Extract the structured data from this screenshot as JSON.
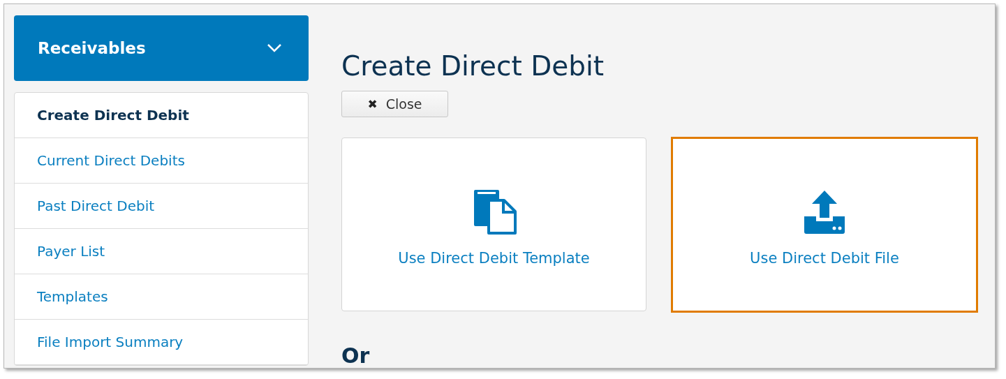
{
  "sidebar": {
    "header": {
      "title": "Receivables",
      "expanded": true
    },
    "items": [
      {
        "label": "Create Direct Debit",
        "selected": true
      },
      {
        "label": "Current Direct Debits",
        "selected": false
      },
      {
        "label": "Past Direct Debit",
        "selected": false
      },
      {
        "label": "Payer List",
        "selected": false
      },
      {
        "label": "Templates",
        "selected": false
      },
      {
        "label": "File Import Summary",
        "selected": false
      }
    ]
  },
  "main": {
    "title": "Create Direct Debit",
    "close_button": {
      "icon": "✖",
      "label": "Close"
    },
    "options": [
      {
        "kind": "template",
        "label": "Use Direct Debit Template",
        "highlighted": false
      },
      {
        "kind": "file",
        "label": "Use Direct Debit File",
        "highlighted": true
      }
    ],
    "section_heading": "Or"
  }
}
